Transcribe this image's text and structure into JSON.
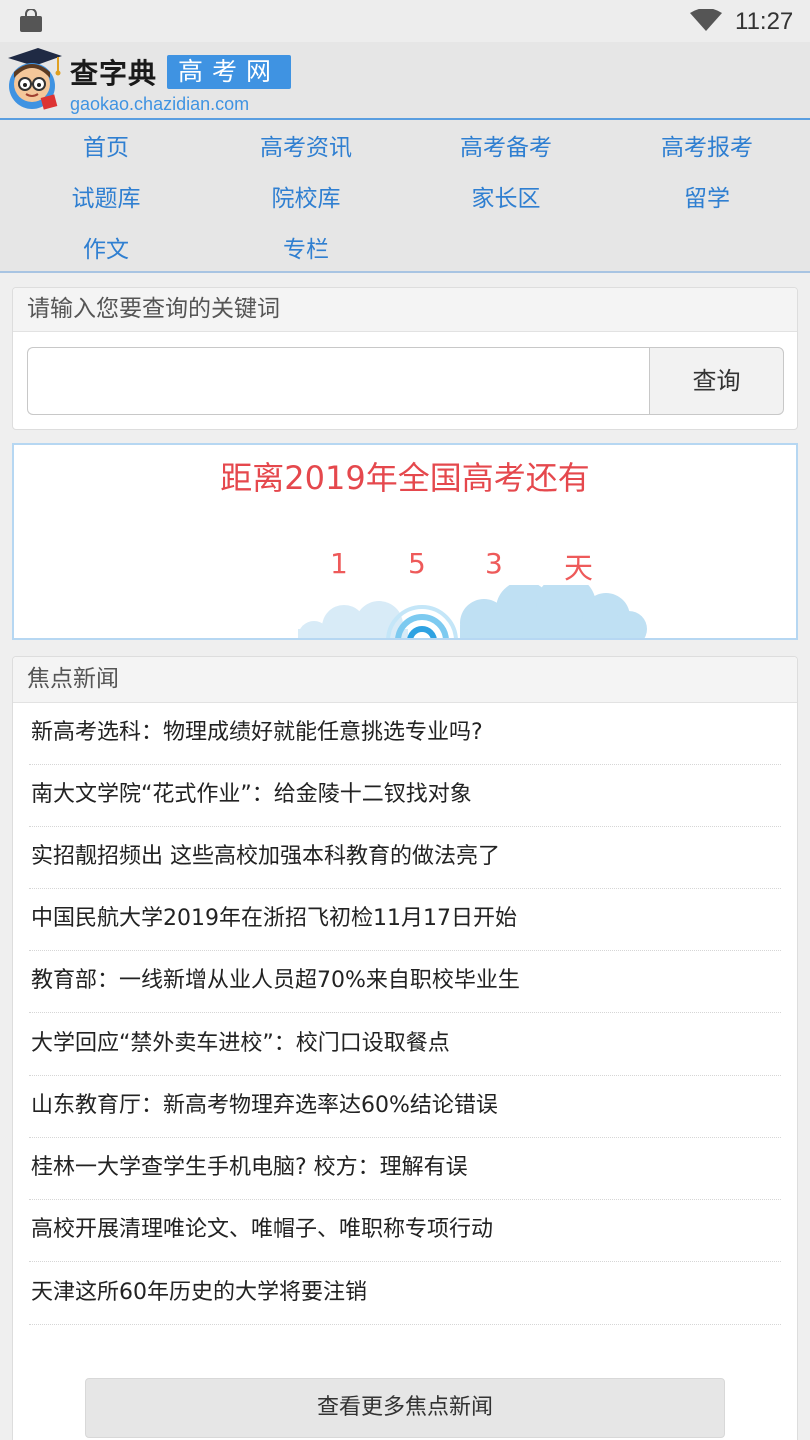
{
  "status_bar": {
    "time": "11:27",
    "icons": [
      "shopping-bag-icon",
      "wifi-icon"
    ]
  },
  "header": {
    "logo_name": "查字典",
    "logo_badge": "高考网",
    "logo_domain": "gaokao.chazidian.com",
    "accent_color": "#3f93e2"
  },
  "nav": {
    "items": [
      {
        "label": "首页"
      },
      {
        "label": "高考资讯"
      },
      {
        "label": "高考备考"
      },
      {
        "label": "高考报考"
      },
      {
        "label": "试题库"
      },
      {
        "label": "院校库"
      },
      {
        "label": "家长区"
      },
      {
        "label": "留学"
      },
      {
        "label": "作文"
      },
      {
        "label": "专栏"
      }
    ],
    "link_color": "#2f7fd1"
  },
  "search": {
    "heading": "请输入您要查询的关键词",
    "value": "",
    "button_label": "查询"
  },
  "countdown": {
    "title": "距离2019年全国高考还有",
    "digits": [
      "1",
      "5",
      "3"
    ],
    "days_value": 153,
    "unit": "天",
    "color": "#e5484d"
  },
  "news": {
    "heading": "焦点新闻",
    "items": [
      {
        "title": "新高考选科：物理成绩好就能任意挑选专业吗?"
      },
      {
        "title": "南大文学院“花式作业”：给金陵十二钗找对象"
      },
      {
        "title": "实招靓招频出 这些高校加强本科教育的做法亮了"
      },
      {
        "title": "中国民航大学2019年在浙招飞初检11月17日开始"
      },
      {
        "title": "教育部：一线新增从业人员超70%来自职校毕业生"
      },
      {
        "title": "大学回应“禁外卖车进校”：校门口设取餐点"
      },
      {
        "title": "山东教育厅：新高考物理弃选率达60%结论错误"
      },
      {
        "title": "桂林一大学查学生手机电脑? 校方：理解有误"
      },
      {
        "title": "高校开展清理唯论文、唯帽子、唯职称专项行动"
      },
      {
        "title": "天津这所60年历史的大学将要注销"
      }
    ],
    "more_label": "查看更多焦点新闻"
  }
}
